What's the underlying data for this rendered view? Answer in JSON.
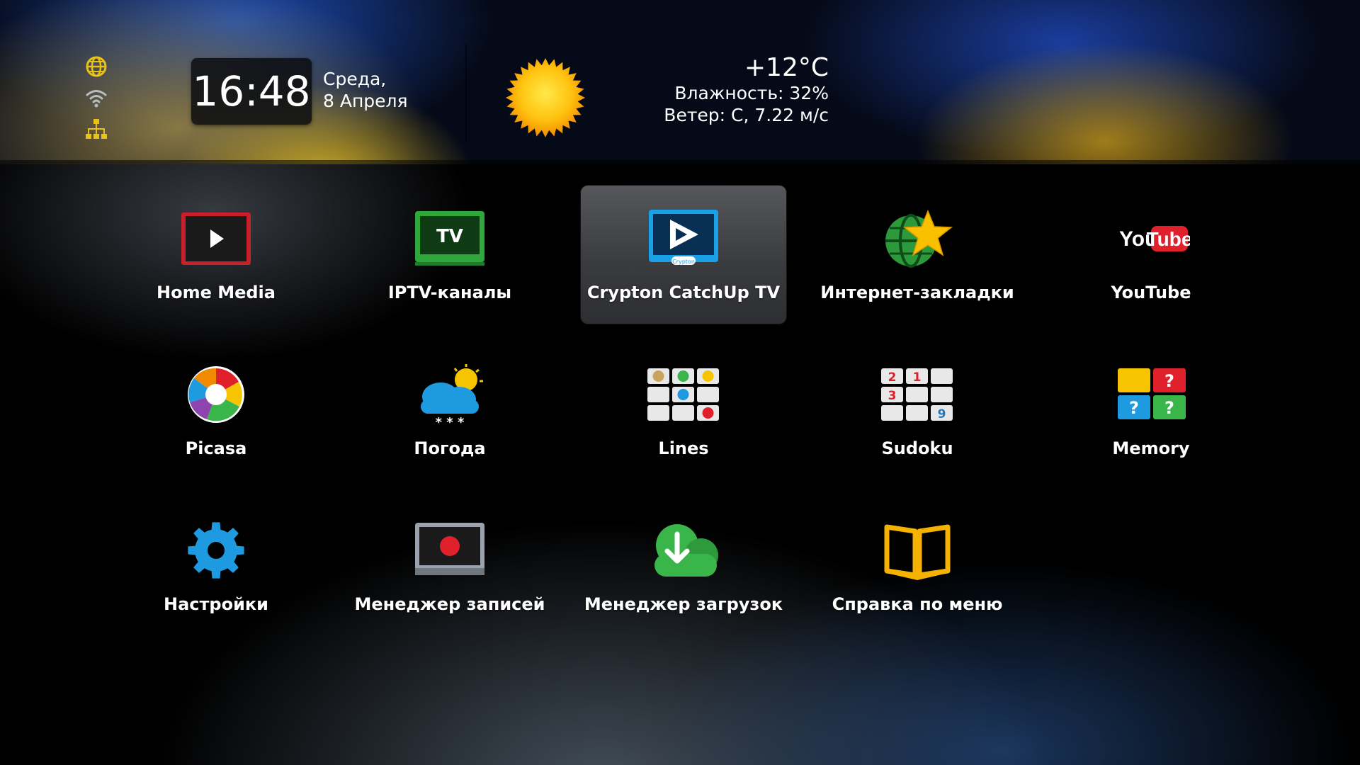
{
  "status": {
    "icons": [
      "globe-icon",
      "wifi-icon",
      "network-icon"
    ],
    "icon_color": "#e8c21a"
  },
  "clock": {
    "time": "16:48",
    "day": "Среда,",
    "date": "8 Апреля"
  },
  "weather": {
    "icon": "sun-icon",
    "temperature": "+12°C",
    "humidity": "Влажность: 32%",
    "wind": "Ветер: С, 7.22 м/с"
  },
  "apps": [
    {
      "label": "Home Media",
      "icon": "home-media-icon"
    },
    {
      "label": "IPTV-каналы",
      "icon": "tv-icon"
    },
    {
      "label": "Crypton CatchUp TV",
      "icon": "catchup-tv-icon",
      "focused": true
    },
    {
      "label": "Интернет-закладки",
      "icon": "bookmark-globe-star-icon"
    },
    {
      "label": "YouTube",
      "icon": "youtube-logo-icon"
    },
    {
      "label": "Picasa",
      "icon": "picasa-icon"
    },
    {
      "label": "Погода",
      "icon": "weather-cloud-icon"
    },
    {
      "label": "Lines",
      "icon": "lines-game-icon"
    },
    {
      "label": "Sudoku",
      "icon": "sudoku-icon"
    },
    {
      "label": "Memory",
      "icon": "memory-game-icon"
    },
    {
      "label": "Настройки",
      "icon": "gear-icon"
    },
    {
      "label": "Менеджер записей",
      "icon": "record-icon"
    },
    {
      "label": "Менеджер загрузок",
      "icon": "download-cloud-icon"
    },
    {
      "label": "Справка по меню",
      "icon": "book-icon"
    }
  ],
  "icon_text": {
    "tv": "TV",
    "catchup_badge": "Crypton",
    "youtube_you": "You",
    "youtube_tube": "Tube",
    "weather_snow": "* * *",
    "sudoku_digits": [
      "2",
      "1",
      "3",
      "9"
    ],
    "memory_mark": "?"
  },
  "colors": {
    "focus_tile": "#45474a",
    "accent_blue": "#1e9be0",
    "accent_red": "#e0202a",
    "accent_green": "#3ab54a",
    "accent_yellow": "#f6c400"
  }
}
